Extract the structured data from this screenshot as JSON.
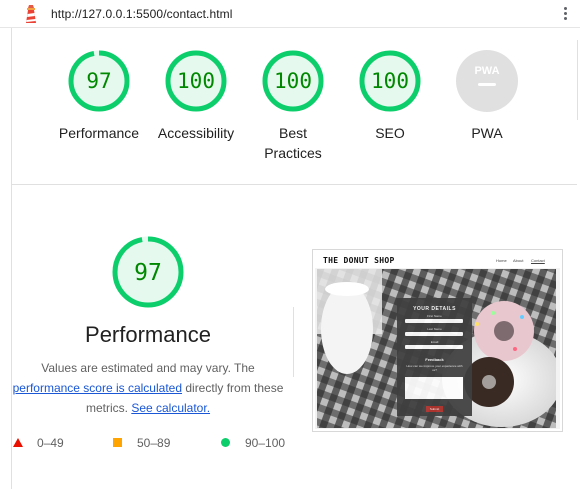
{
  "topbar": {
    "url": "http://127.0.0.1:5500/contact.html",
    "logo_icon": "lighthouse-icon",
    "menu_icon": "kebab-menu-icon"
  },
  "colors": {
    "pass": "#0cce6b",
    "pass_text": "#008800",
    "pass_fill": "#e6f9ee",
    "average": "#ffa400",
    "fail": "#eb0f00",
    "pwa_gray": "#e0e0e0",
    "link": "#1a57d6"
  },
  "gauges": [
    {
      "score": "97",
      "label": "Performance",
      "value": 97
    },
    {
      "score": "100",
      "label": "Accessibility",
      "value": 100
    },
    {
      "score": "100",
      "label": "Best Practices",
      "value": 100
    },
    {
      "score": "100",
      "label": "SEO",
      "value": 100
    },
    {
      "score": "PWA",
      "label": "PWA",
      "value": null
    }
  ],
  "performance": {
    "score": "97",
    "value": 97,
    "title": "Performance",
    "desc_before": "Values are estimated and may vary. The ",
    "desc_link": "performance score is calculated",
    "desc_after": " directly from these metrics. ",
    "calc_link": "See calculator."
  },
  "legend": [
    {
      "shape": "triangle",
      "range": "0–49"
    },
    {
      "shape": "square",
      "range": "50–89"
    },
    {
      "shape": "circle",
      "range": "90–100"
    }
  ],
  "screenshot": {
    "site_title": "THE DONUT SHOP",
    "nav": [
      "Home",
      "About",
      "Contact"
    ],
    "form_title": "YOUR DETAILS",
    "form_labels": [
      "First Name",
      "Last Name",
      "Email",
      "Feedback",
      "How can we improve your experience with us?"
    ],
    "submit": "Submit"
  }
}
